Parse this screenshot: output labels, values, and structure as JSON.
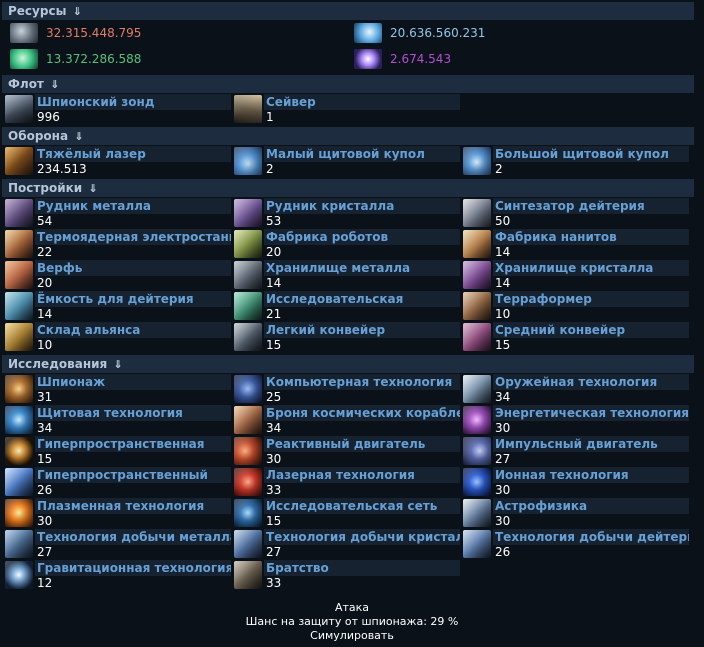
{
  "sections": {
    "resources": "Ресурсы",
    "fleet": "Флот",
    "defense": "Оборона",
    "buildings": "Постройки",
    "research": "Исследования",
    "arrow": "⇓"
  },
  "resources": [
    {
      "value": "32.315.448.795",
      "color": "#e07d66",
      "icon": "metal-icon"
    },
    {
      "value": "20.636.560.231",
      "color": "#8ec7e8",
      "icon": "crystal-icon"
    },
    {
      "value": "13.372.286.588",
      "color": "#58c07b",
      "icon": "deuterium-icon"
    },
    {
      "value": "2.674.543",
      "color": "#b34ecf",
      "icon": "dark-matter-icon"
    }
  ],
  "fleet": [
    {
      "name": "Шпионский зонд",
      "count": "996",
      "icon": "espionage-probe-icon"
    },
    {
      "name": "Сейвер",
      "count": "1",
      "icon": "saver-ship-icon"
    }
  ],
  "defense": [
    {
      "name": "Тяжёлый лазер",
      "count": "234.513",
      "icon": "heavy-laser-icon"
    },
    {
      "name": "Малый щитовой купол",
      "count": "2",
      "icon": "small-shield-dome-icon"
    },
    {
      "name": "Большой щитовой купол",
      "count": "2",
      "icon": "large-shield-dome-icon"
    }
  ],
  "buildings": [
    {
      "name": "Рудник металла",
      "count": "54",
      "icon": "metal-mine-icon"
    },
    {
      "name": "Рудник кристалла",
      "count": "53",
      "icon": "crystal-mine-icon"
    },
    {
      "name": "Синтезатор дейтерия",
      "count": "50",
      "icon": "deuterium-synthesizer-icon"
    },
    {
      "name": "Термоядерная электростанция",
      "count": "22",
      "icon": "fusion-plant-icon"
    },
    {
      "name": "Фабрика роботов",
      "count": "20",
      "icon": "robot-factory-icon"
    },
    {
      "name": "Фабрика нанитов",
      "count": "14",
      "icon": "nanite-factory-icon"
    },
    {
      "name": "Верфь",
      "count": "20",
      "icon": "shipyard-icon"
    },
    {
      "name": "Хранилище металла",
      "count": "14",
      "icon": "metal-storage-icon"
    },
    {
      "name": "Хранилище кристалла",
      "count": "14",
      "icon": "crystal-storage-icon"
    },
    {
      "name": "Ёмкость для дейтерия",
      "count": "14",
      "icon": "deuterium-tank-icon"
    },
    {
      "name": "Исследовательская",
      "count": "21",
      "icon": "research-lab-icon"
    },
    {
      "name": "Терраформер",
      "count": "10",
      "icon": "terraformer-icon"
    },
    {
      "name": "Склад альянса",
      "count": "10",
      "icon": "alliance-depot-icon"
    },
    {
      "name": "Легкий конвейер",
      "count": "15",
      "icon": "light-conveyor-icon"
    },
    {
      "name": "Средний конвейер",
      "count": "15",
      "icon": "medium-conveyor-icon"
    }
  ],
  "research": [
    {
      "name": "Шпионаж",
      "count": "31",
      "icon": "espionage-tech-icon"
    },
    {
      "name": "Компьютерная технология",
      "count": "25",
      "icon": "computer-tech-icon"
    },
    {
      "name": "Оружейная технология",
      "count": "34",
      "icon": "weapons-tech-icon"
    },
    {
      "name": "Щитовая технология",
      "count": "34",
      "icon": "shield-tech-icon"
    },
    {
      "name": "Броня космических кораблей",
      "count": "34",
      "icon": "armour-tech-icon"
    },
    {
      "name": "Энергетическая технология",
      "count": "30",
      "icon": "energy-tech-icon"
    },
    {
      "name": "Гиперпространственная",
      "count": "15",
      "icon": "hyperspace-tech-icon"
    },
    {
      "name": "Реактивный двигатель",
      "count": "30",
      "icon": "combustion-drive-icon"
    },
    {
      "name": "Импульсный двигатель",
      "count": "27",
      "icon": "impulse-drive-icon"
    },
    {
      "name": "Гиперпространственный",
      "count": "26",
      "icon": "hyperspace-drive-icon"
    },
    {
      "name": "Лазерная технология",
      "count": "33",
      "icon": "laser-tech-icon"
    },
    {
      "name": "Ионная технология",
      "count": "30",
      "icon": "ion-tech-icon"
    },
    {
      "name": "Плазменная технология",
      "count": "30",
      "icon": "plasma-tech-icon"
    },
    {
      "name": "Исследовательская сеть",
      "count": "15",
      "icon": "research-network-icon"
    },
    {
      "name": "Астрофизика",
      "count": "30",
      "icon": "astrophysics-icon"
    },
    {
      "name": "Технология добычи металла",
      "count": "27",
      "icon": "metal-extraction-tech-icon"
    },
    {
      "name": "Технология добычи кристалла",
      "count": "27",
      "icon": "crystal-extraction-tech-icon"
    },
    {
      "name": "Технология добычи дейтерия",
      "count": "26",
      "icon": "deuterium-extraction-tech-icon"
    },
    {
      "name": "Гравитационная технология",
      "count": "12",
      "icon": "graviton-tech-icon"
    },
    {
      "name": "Братство",
      "count": "33",
      "icon": "brotherhood-icon"
    }
  ],
  "footer": {
    "attack": "Атака",
    "defense_chance": "Шанс на защиту от шпионажа: 29 %",
    "simulate": "Симулировать"
  }
}
